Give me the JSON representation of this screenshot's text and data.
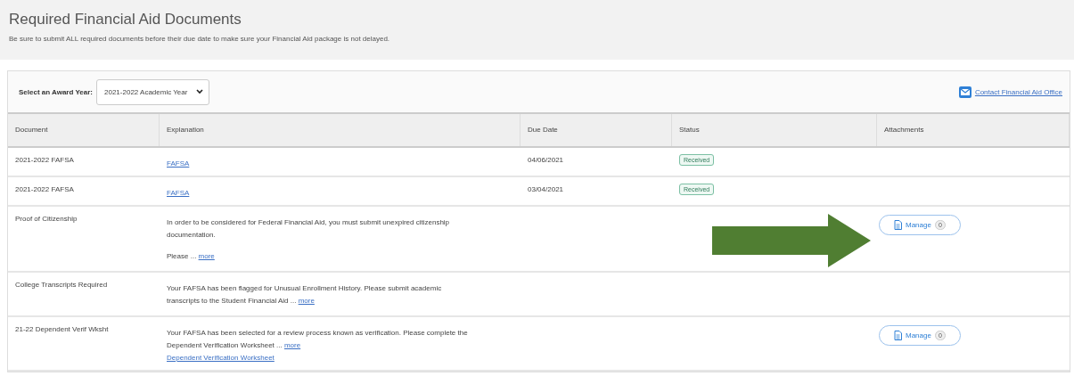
{
  "header": {
    "title": "Required Financial Aid Documents",
    "subtitle": "Be sure to submit ALL required documents before their due date to make sure your Financial Aid package is not delayed."
  },
  "toolbar": {
    "award_year_label": "Select an Award Year:",
    "award_year_value": "2021-2022 Academic Year",
    "contact_link": "Contact Financial Aid Office"
  },
  "table": {
    "columns": [
      "Document",
      "Explanation",
      "Due Date",
      "Status",
      "Attachments"
    ],
    "rows": [
      {
        "document": "2021-2022 FAFSA",
        "paragraphs": [],
        "links": [
          "FAFSA"
        ],
        "due_date": "04/06/2021",
        "status": "Received",
        "attachments": null,
        "highlighted": false
      },
      {
        "document": "2021-2022 FAFSA",
        "paragraphs": [],
        "links": [
          "FAFSA"
        ],
        "due_date": "03/04/2021",
        "status": "Received",
        "attachments": null,
        "highlighted": false
      },
      {
        "document": "Proof of Citizenship",
        "paragraphs": [
          {
            "text": "In order to be considered for Federal Financial Aid, you must submit unexpired citizenship documentation."
          },
          {
            "text": "Please ...",
            "more": "more"
          }
        ],
        "links": [],
        "due_date": null,
        "status": null,
        "attachments": {
          "label": "Manage",
          "count": "0"
        },
        "highlighted": true
      },
      {
        "document": "College Transcripts Required",
        "paragraphs": [
          {
            "text": "Your FAFSA has been flagged for Unusual Enrollment History. Please submit academic transcripts to the Student Financial Aid ...",
            "more": "more"
          }
        ],
        "links": [],
        "due_date": null,
        "status": null,
        "attachments": null,
        "highlighted": false
      },
      {
        "document": "21-22 Dependent Verif Wksht",
        "paragraphs": [
          {
            "text": "Your FAFSA has been selected for a review process known as verification. Please complete the Dependent Verification Worksheet ...",
            "more": "more"
          }
        ],
        "links": [
          "Dependent Verification Worksheet"
        ],
        "due_date": null,
        "status": null,
        "attachments": {
          "label": "Manage",
          "count": "0"
        },
        "highlighted": false
      }
    ]
  }
}
